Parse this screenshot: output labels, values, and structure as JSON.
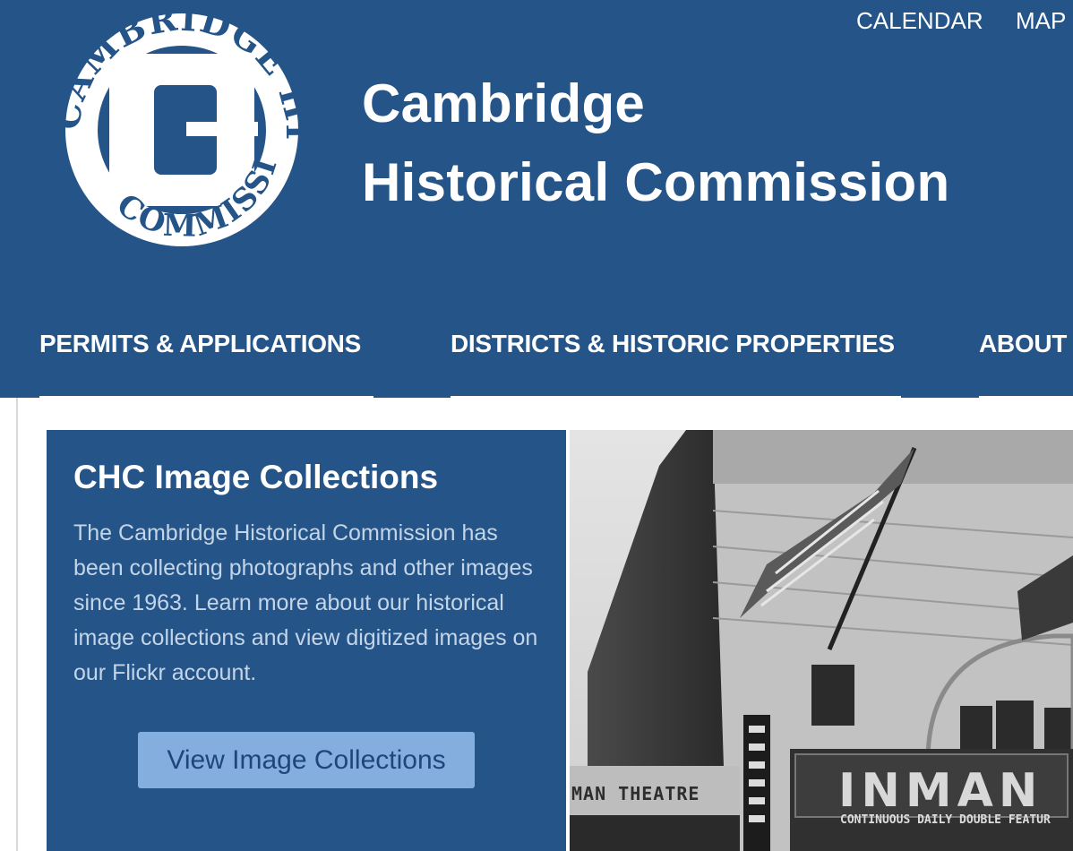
{
  "logo": {
    "ring_text": "CAMBRIDGE HISTORICAL COMMISSION",
    "accent": "#245488"
  },
  "top_links": [
    "CALENDAR",
    "MAP"
  ],
  "site_title": [
    "Cambridge",
    "Historical Commission"
  ],
  "main_nav": [
    "PERMITS & APPLICATIONS",
    "DISTRICTS & HISTORIC PROPERTIES",
    "ABOUT"
  ],
  "promo": {
    "title": "CHC Image Collections",
    "text": "The Cambridge Historical Commission has been collecting photographs and other images since 1963. Learn more about our historical image collections and view digitized images on our Flickr account.",
    "button_label": "View Image Collections"
  },
  "photo": {
    "marquee": "INMAN",
    "marquee_sub": "CONTINUOUS DAILY   DOUBLE FEATUR",
    "side_sign": "MAN THEATRE"
  },
  "colors": {
    "brand_blue": "#245488",
    "button_blue": "#83aede",
    "promo_text": "#c4d5e8"
  }
}
